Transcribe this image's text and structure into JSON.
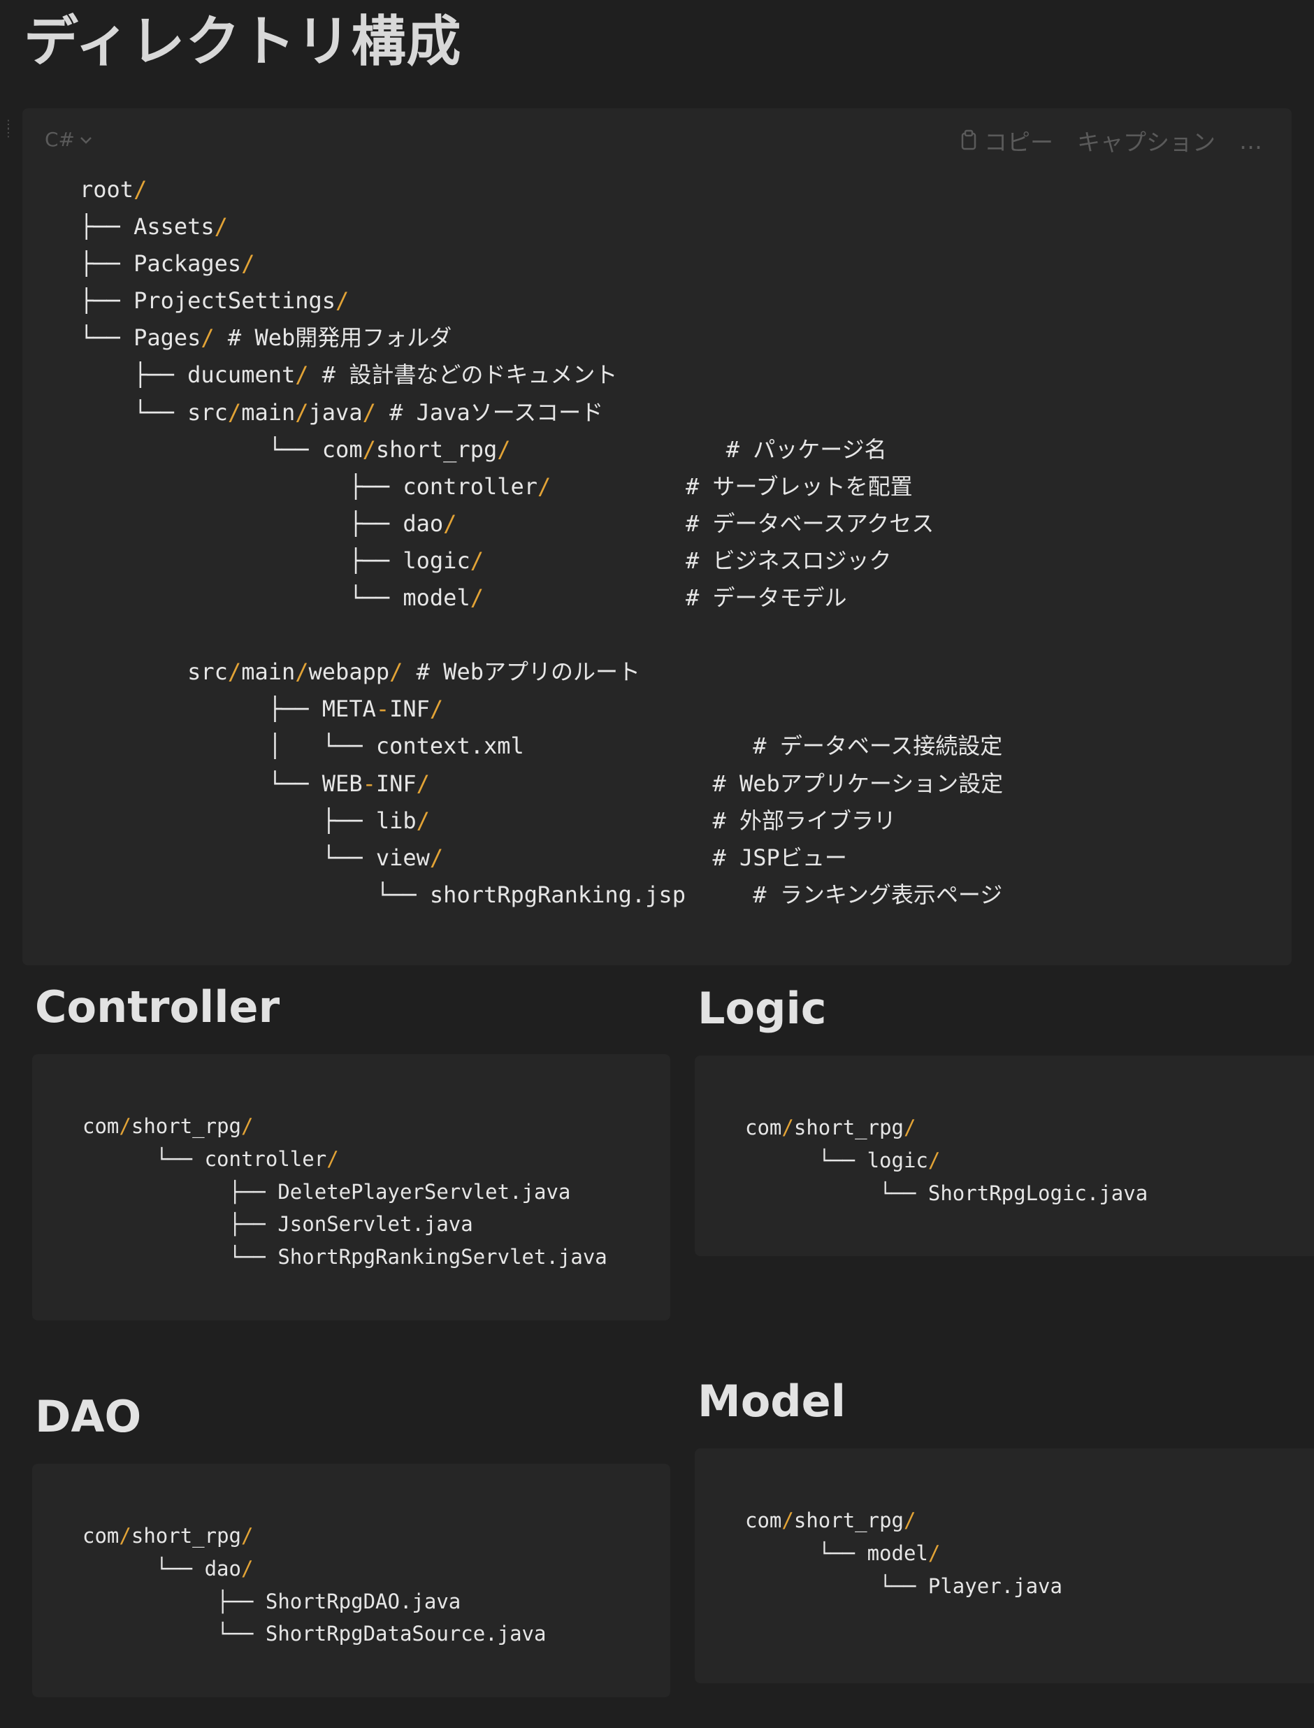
{
  "page": {
    "title": "ディレクトリ構成"
  },
  "main_block": {
    "language": "C#",
    "copy_label": "コピー",
    "caption_label": "キャプション",
    "more_label": "…",
    "lines": [
      [
        {
          "t": "root"
        },
        {
          "t": "/",
          "c": "slash"
        }
      ],
      [
        {
          "t": "├── Assets"
        },
        {
          "t": "/",
          "c": "slash"
        }
      ],
      [
        {
          "t": "├── Packages"
        },
        {
          "t": "/",
          "c": "slash"
        }
      ],
      [
        {
          "t": "├── ProjectSettings"
        },
        {
          "t": "/",
          "c": "slash"
        }
      ],
      [
        {
          "t": "└── Pages"
        },
        {
          "t": "/",
          "c": "slash"
        },
        {
          "t": " # Web開発用フォルダ",
          "c": "comment"
        }
      ],
      [
        {
          "t": "    ├── ducument"
        },
        {
          "t": "/",
          "c": "slash"
        },
        {
          "t": " # 設計書などのドキュメント",
          "c": "comment"
        }
      ],
      [
        {
          "t": "    └── src"
        },
        {
          "t": "/",
          "c": "slash"
        },
        {
          "t": "main"
        },
        {
          "t": "/",
          "c": "slash"
        },
        {
          "t": "java"
        },
        {
          "t": "/",
          "c": "slash"
        },
        {
          "t": " # Javaソースコード",
          "c": "comment"
        }
      ],
      [
        {
          "t": "              └── com"
        },
        {
          "t": "/",
          "c": "slash"
        },
        {
          "t": "short_rpg"
        },
        {
          "t": "/",
          "c": "slash"
        },
        {
          "t": "                # パッケージ名",
          "c": "comment"
        }
      ],
      [
        {
          "t": "                    ├── controller"
        },
        {
          "t": "/",
          "c": "slash"
        },
        {
          "t": "          # サーブレットを配置",
          "c": "comment"
        }
      ],
      [
        {
          "t": "                    ├── dao"
        },
        {
          "t": "/",
          "c": "slash"
        },
        {
          "t": "                 # データベースアクセス",
          "c": "comment"
        }
      ],
      [
        {
          "t": "                    ├── logic"
        },
        {
          "t": "/",
          "c": "slash"
        },
        {
          "t": "               # ビジネスロジック",
          "c": "comment"
        }
      ],
      [
        {
          "t": "                    └── model"
        },
        {
          "t": "/",
          "c": "slash"
        },
        {
          "t": "               # データモデル",
          "c": "comment"
        }
      ],
      [
        {
          "t": ""
        }
      ],
      [
        {
          "t": "        src"
        },
        {
          "t": "/",
          "c": "slash"
        },
        {
          "t": "main"
        },
        {
          "t": "/",
          "c": "slash"
        },
        {
          "t": "webapp"
        },
        {
          "t": "/",
          "c": "slash"
        },
        {
          "t": " # Webアプリのルート",
          "c": "comment"
        }
      ],
      [
        {
          "t": "              ├── META"
        },
        {
          "t": "-",
          "c": "slash"
        },
        {
          "t": "INF"
        },
        {
          "t": "/",
          "c": "slash"
        }
      ],
      [
        {
          "t": "              │   └── context.xml                 # データベース接続設定"
        }
      ],
      [
        {
          "t": "              └── WEB"
        },
        {
          "t": "-",
          "c": "slash"
        },
        {
          "t": "INF"
        },
        {
          "t": "/",
          "c": "slash"
        },
        {
          "t": "                     # Webアプリケーション設定",
          "c": "comment"
        }
      ],
      [
        {
          "t": "                  ├── lib"
        },
        {
          "t": "/",
          "c": "slash"
        },
        {
          "t": "                     # 外部ライブラリ",
          "c": "comment"
        }
      ],
      [
        {
          "t": "                  └── view"
        },
        {
          "t": "/",
          "c": "slash"
        },
        {
          "t": "                    # JSPビュー",
          "c": "comment"
        }
      ],
      [
        {
          "t": "                      └── shortRpgRanking.jsp     # ランキング表示ページ"
        }
      ]
    ]
  },
  "sections": {
    "controller": {
      "title": "Controller",
      "lines": [
        [
          {
            "t": "com"
          },
          {
            "t": "/",
            "c": "slash"
          },
          {
            "t": "short_rpg"
          },
          {
            "t": "/",
            "c": "slash"
          }
        ],
        [
          {
            "t": "      └── controller"
          },
          {
            "t": "/",
            "c": "slash"
          }
        ],
        [
          {
            "t": "            ├── DeletePlayerServlet.java"
          }
        ],
        [
          {
            "t": "            ├── JsonServlet.java"
          }
        ],
        [
          {
            "t": "            └── ShortRpgRankingServlet.java"
          }
        ]
      ]
    },
    "logic": {
      "title": "Logic",
      "lines": [
        [
          {
            "t": "com"
          },
          {
            "t": "/",
            "c": "slash"
          },
          {
            "t": "short_rpg"
          },
          {
            "t": "/",
            "c": "slash"
          }
        ],
        [
          {
            "t": "      └── logic"
          },
          {
            "t": "/",
            "c": "slash"
          }
        ],
        [
          {
            "t": "           └── ShortRpgLogic.java"
          }
        ]
      ]
    },
    "dao": {
      "title": "DAO",
      "lines": [
        [
          {
            "t": "com"
          },
          {
            "t": "/",
            "c": "slash"
          },
          {
            "t": "short_rpg"
          },
          {
            "t": "/",
            "c": "slash"
          }
        ],
        [
          {
            "t": "      └── dao"
          },
          {
            "t": "/",
            "c": "slash"
          }
        ],
        [
          {
            "t": "           ├── ShortRpgDAO.java"
          }
        ],
        [
          {
            "t": "           └── ShortRpgDataSource.java"
          }
        ]
      ]
    },
    "model": {
      "title": "Model",
      "lines": [
        [
          {
            "t": "com"
          },
          {
            "t": "/",
            "c": "slash"
          },
          {
            "t": "short_rpg"
          },
          {
            "t": "/",
            "c": "slash"
          }
        ],
        [
          {
            "t": "      └── model"
          },
          {
            "t": "/",
            "c": "slash"
          }
        ],
        [
          {
            "t": "           └── Player.java"
          }
        ]
      ]
    }
  }
}
